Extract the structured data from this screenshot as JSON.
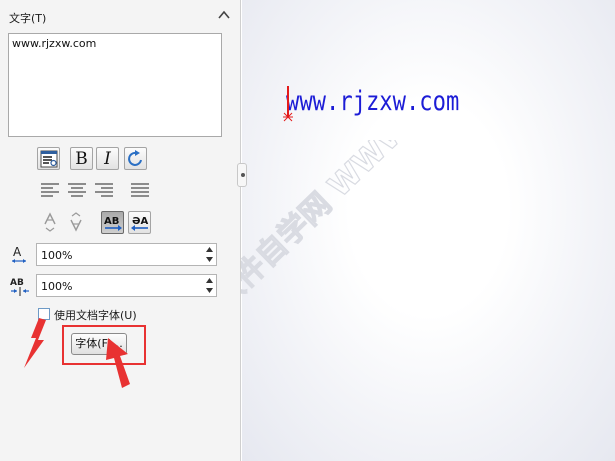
{
  "panel": {
    "group_title": "文字(T)",
    "text_content": "www.rjzxw.com",
    "width_factor": "100%",
    "spacing": "100%",
    "use_doc_font_label": "使用文档字体(U)",
    "use_doc_font_checked": false,
    "font_button_label": "字体(F)...",
    "tool_icons": [
      "insert-link-icon",
      "bold-icon",
      "italic-icon",
      "rotate-icon"
    ],
    "align_icons": [
      "align-left-icon",
      "align-center-icon",
      "align-right-icon",
      "justify-icon"
    ],
    "flip_icons": [
      "flip-up-icon",
      "flip-down-icon",
      "text-direction-forward-icon",
      "text-direction-backward-icon"
    ]
  },
  "canvas": {
    "text": "www.rjzxw.com",
    "text_color": "#1c1cd6",
    "watermark": "软件自学网 WWW.RJZXW.COM"
  },
  "colors": {
    "annotation_red": "#e83232",
    "checkbox_border": "#6e9ac6"
  }
}
